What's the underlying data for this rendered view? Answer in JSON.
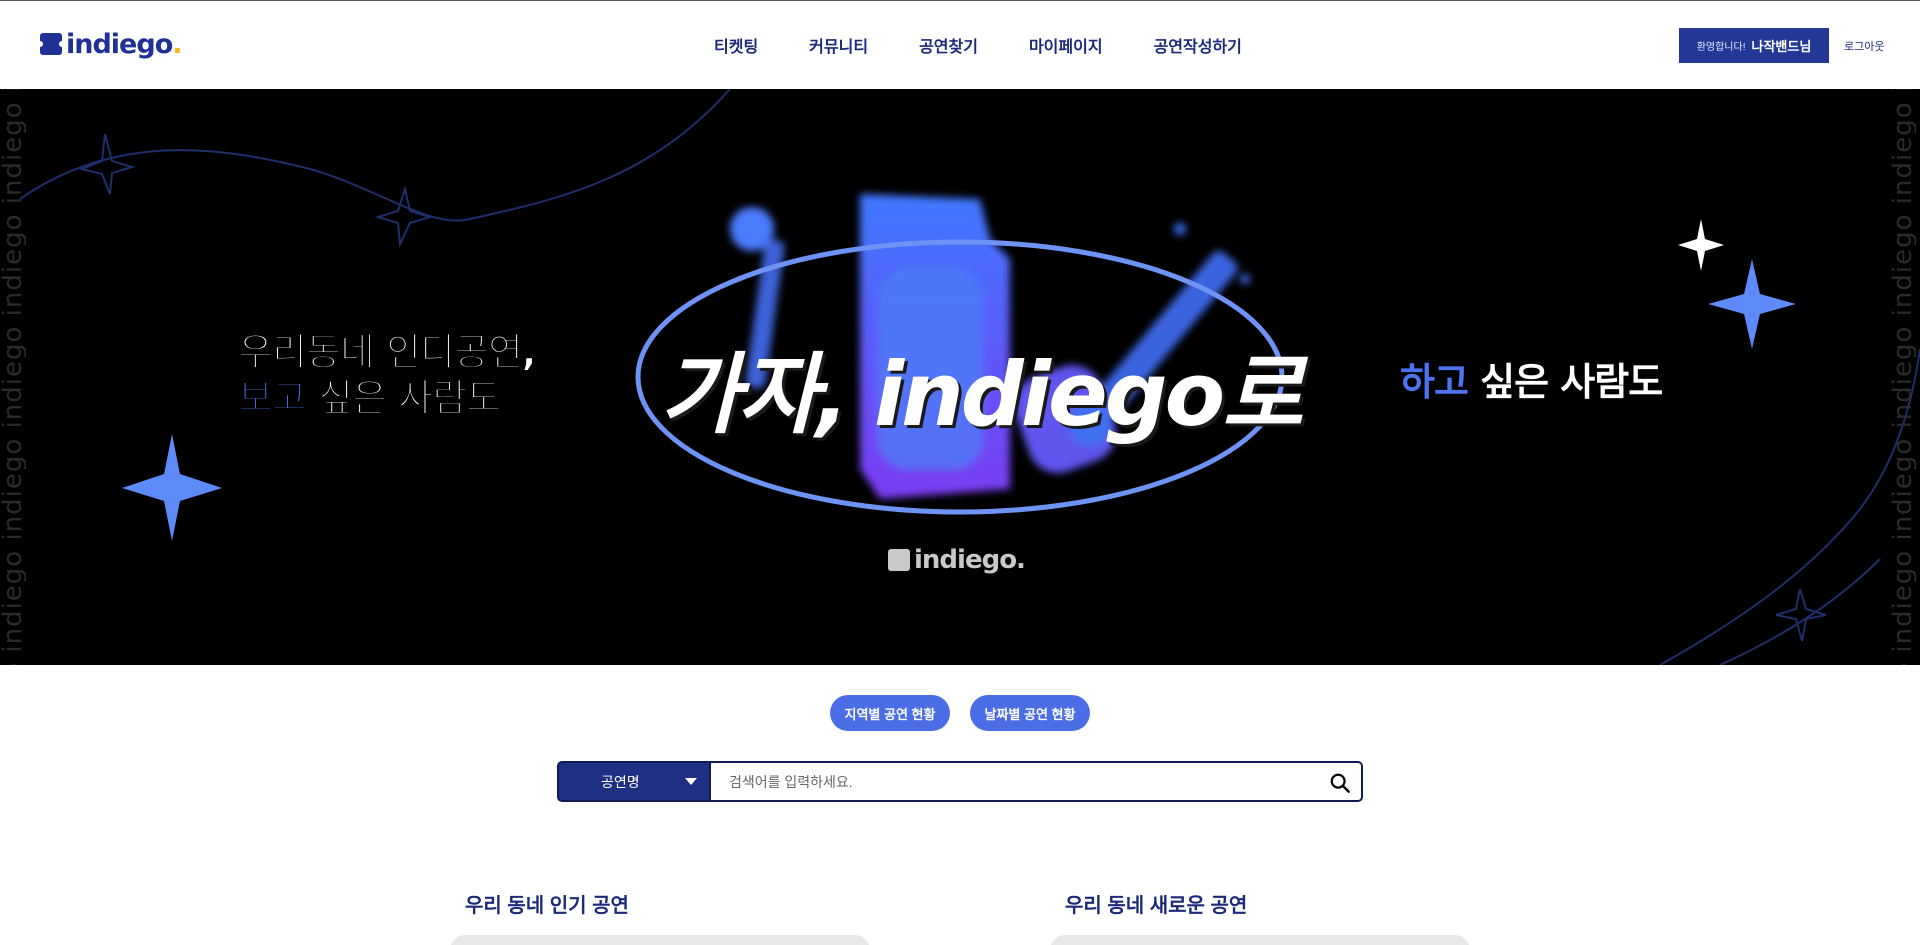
{
  "header": {
    "logo": "indiego",
    "nav": [
      {
        "label": "티켓팅"
      },
      {
        "label": "커뮤니티"
      },
      {
        "label": "공연찾기"
      },
      {
        "label": "마이페이지"
      },
      {
        "label": "공연작성하기"
      }
    ],
    "welcome_text": "환영합니다!",
    "user_name": "나작밴드님",
    "logout_label": "로그아웃"
  },
  "banner": {
    "side_text": "indiego indiego indiego indiego indiego indiego indiego",
    "tagline_left_line1": "우리동네 인디공연,",
    "tagline_left_highlight": "보고",
    "tagline_left_line2_rest": " 싶은 사람도",
    "headline": "가자, indiego로",
    "tagline_right_highlight": "하고",
    "tagline_right_rest": " 싶은 사람도",
    "banner_logo": "indiego."
  },
  "filters": {
    "region_label": "지역별 공연 현황",
    "date_label": "날짜별 공연 현황"
  },
  "search": {
    "category_selected": "공연명",
    "placeholder": "검색어를 입력하세요."
  },
  "sections": {
    "popular_title": "우리 동네 인기 공연",
    "new_title": "우리 동네 새로운 공연"
  },
  "colors": {
    "navy": "#1f3196",
    "accent_blue": "#4b6ee7",
    "logo_dot": "#f2b81d",
    "banner_bg": "#000000"
  }
}
